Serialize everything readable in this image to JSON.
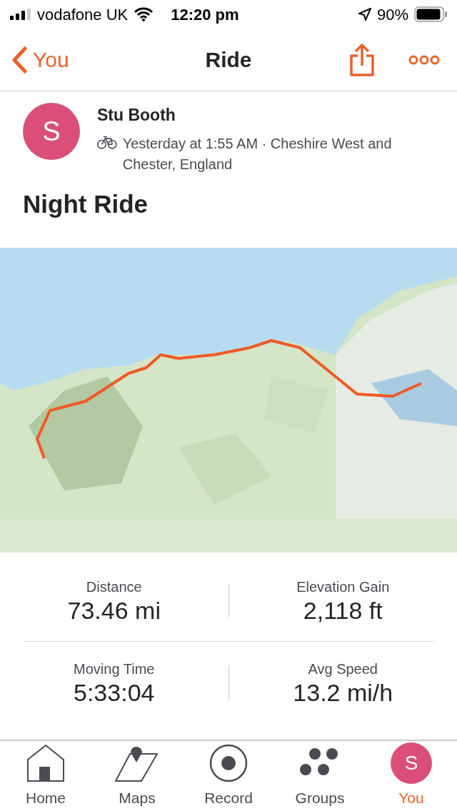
{
  "status_bar": {
    "carrier": "vodafone UK",
    "time": "12:20 pm",
    "battery": "90%"
  },
  "nav": {
    "back_label": "You",
    "title": "Ride"
  },
  "athlete": {
    "initial": "S",
    "name": "Stu Booth",
    "meta": "Yesterday at 1:55 AM · Cheshire West and Chester, England"
  },
  "activity_title": "Night Ride",
  "stats": [
    {
      "label": "Distance",
      "value": "73.46 mi"
    },
    {
      "label": "Elevation Gain",
      "value": "2,118 ft"
    },
    {
      "label": "Moving Time",
      "value": "5:33:04"
    },
    {
      "label": "Avg Speed",
      "value": "13.2 mi/h"
    }
  ],
  "tab_bar": [
    {
      "kind": "home",
      "label": "Home",
      "selected": false
    },
    {
      "kind": "maps",
      "label": "Maps",
      "selected": false
    },
    {
      "kind": "record",
      "label": "Record",
      "selected": false
    },
    {
      "kind": "groups",
      "label": "Groups",
      "selected": false
    },
    {
      "kind": "avatar",
      "label": "You",
      "initial": "S",
      "selected": true
    }
  ]
}
